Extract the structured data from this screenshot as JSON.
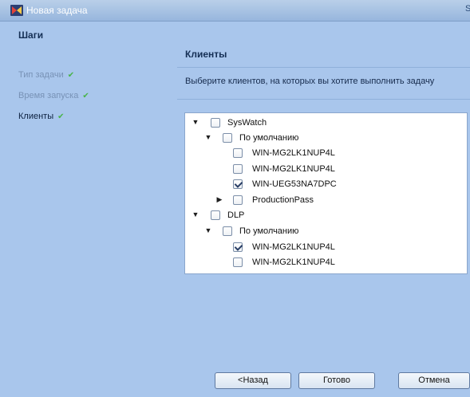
{
  "window": {
    "title": "Новая задача",
    "title_right": "S"
  },
  "steps": {
    "heading": "Шаги",
    "items": [
      {
        "label": "Тип задачи",
        "mark": "✔"
      },
      {
        "label": "Время запуска",
        "mark": "✔"
      },
      {
        "label": "Клиенты",
        "mark": "✔"
      }
    ]
  },
  "main": {
    "title": "Клиенты",
    "description": "Выберите клиентов, на которых вы хотите выполнить задачу"
  },
  "tree": {
    "groups": [
      {
        "label": "SysWatch",
        "expanded": true,
        "checked": false,
        "children": [
          {
            "label": "По умолчанию",
            "expanded": true,
            "checked": false,
            "children": [
              {
                "label": "WIN-MG2LK1NUP4L",
                "checked": false
              },
              {
                "label": "WIN-MG2LK1NUP4L",
                "checked": false
              },
              {
                "label": "WIN-UEG53NA7DPC",
                "checked": true
              }
            ]
          },
          {
            "label": "ProductionPass",
            "expanded": false,
            "checked": false
          }
        ]
      },
      {
        "label": "DLP",
        "expanded": true,
        "checked": false,
        "children": [
          {
            "label": "По умолчанию",
            "expanded": true,
            "checked": false,
            "children": [
              {
                "label": "WIN-MG2LK1NUP4L",
                "checked": true
              },
              {
                "label": "WIN-MG2LK1NUP4L",
                "checked": false
              }
            ]
          }
        ]
      }
    ]
  },
  "buttons": {
    "back": "<Назад",
    "done": "Готово",
    "cancel": "Отмена"
  },
  "colors": {
    "background": "#a9c6ec",
    "accent": "#152f55",
    "check": "#49b34a"
  }
}
